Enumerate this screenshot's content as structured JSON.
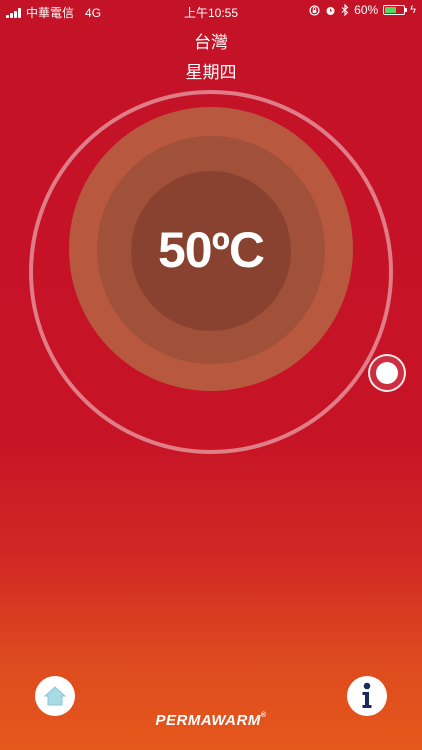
{
  "status_bar": {
    "carrier": "中華電信",
    "network": "4G",
    "time": "上午10:55",
    "battery_percent": "60%",
    "battery_level": 0.6,
    "icons": [
      "signal-icon",
      "rotation-lock-icon",
      "alarm-icon",
      "bluetooth-icon",
      "battery-icon",
      "charging-icon"
    ]
  },
  "header": {
    "location": "台灣",
    "weekday": "星期四"
  },
  "thermostat": {
    "temperature": "50ºC"
  },
  "footer": {
    "home_icon": "home-icon",
    "info_icon": "info-icon",
    "brand": "PERMAWARM",
    "brand_mark": "®"
  },
  "colors": {
    "background_top": "#c41227",
    "background_bottom": "#e5581c",
    "glow_outer": "#b7583f",
    "glow_mid": "#a1503a",
    "glow_inner": "#8a4230",
    "home_icon": "#a8d9e6",
    "info_icon": "#1f2a5c"
  }
}
